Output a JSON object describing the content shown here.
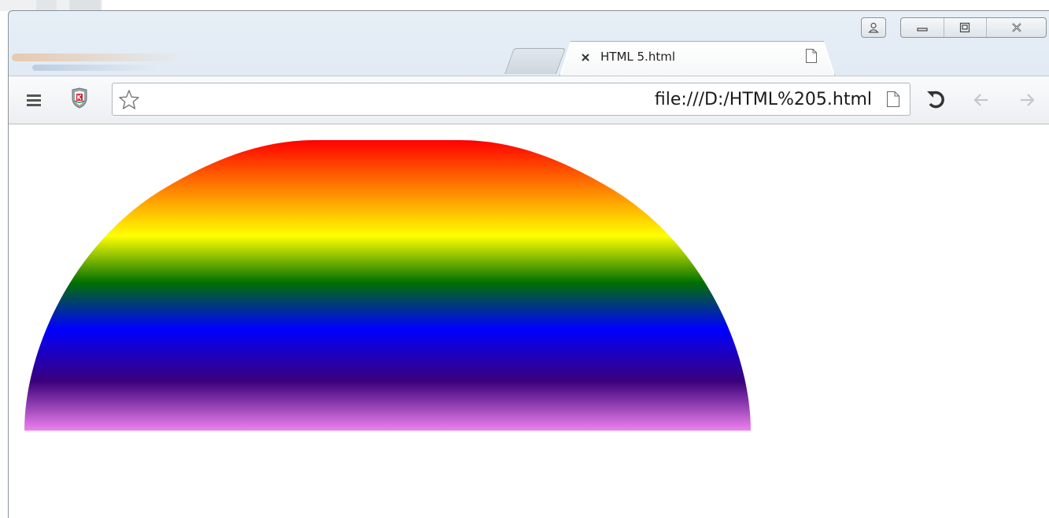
{
  "tab": {
    "title": "HTML 5.html",
    "close_icon": "close-icon",
    "favicon": "page-icon"
  },
  "toolbar": {
    "menu_icon": "hamburger-menu-icon",
    "extension_icon": "kaspersky-shield-icon",
    "bookmark_icon": "star-icon",
    "url": "file:///D:/HTML%205.html",
    "reload_icon": "reload-icon",
    "back_icon": "back-arrow-icon",
    "forward_icon": "forward-arrow-icon"
  },
  "window_controls": [
    "profile-icon",
    "minimize-icon",
    "maximize-icon",
    "close-icon"
  ],
  "page": {
    "shape": "half-ellipse",
    "gradient_stops": [
      {
        "offset": 0.0,
        "color": "#ff0000"
      },
      {
        "offset": 0.33,
        "color": "#ffff00"
      },
      {
        "offset": 0.49,
        "color": "#007000"
      },
      {
        "offset": 0.65,
        "color": "#0000ff"
      },
      {
        "offset": 0.83,
        "color": "#3a007a"
      },
      {
        "offset": 1.0,
        "color": "#ee82ee"
      }
    ]
  }
}
